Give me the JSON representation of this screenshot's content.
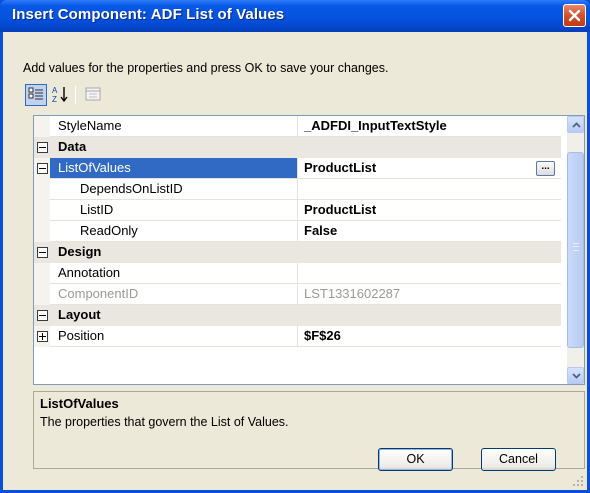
{
  "window": {
    "title": "Insert Component: ADF List of Values"
  },
  "intro_text": "Add values for the properties and press OK to save your changes.",
  "toolbar": {
    "categorized": "categorized-view-icon",
    "alphabetical": "alphabetical-sort-icon",
    "property_pages": "property-pages-icon"
  },
  "grid": {
    "rows": [
      {
        "name": "StyleName",
        "value": "_ADFDI_InputTextStyle"
      },
      {
        "category": "Data"
      },
      {
        "name": "ListOfValues",
        "value": "ProductList"
      },
      {
        "name": "DependsOnListID",
        "value": ""
      },
      {
        "name": "ListID",
        "value": "ProductList"
      },
      {
        "name": "ReadOnly",
        "value": "False"
      },
      {
        "category": "Design"
      },
      {
        "name": "Annotation",
        "value": ""
      },
      {
        "name": "ComponentID",
        "value": "LST1331602287"
      },
      {
        "category": "Layout"
      },
      {
        "name": "Position",
        "value": "$F$26"
      }
    ],
    "ellipsis_label": "..."
  },
  "description": {
    "title": "ListOfValues",
    "text": "The properties that govern the List of Values."
  },
  "buttons": {
    "ok": "OK",
    "cancel": "Cancel"
  },
  "colors": {
    "titlebar": "#0553de",
    "selection": "#316ac5",
    "dialog_bg": "#ece9d8"
  }
}
